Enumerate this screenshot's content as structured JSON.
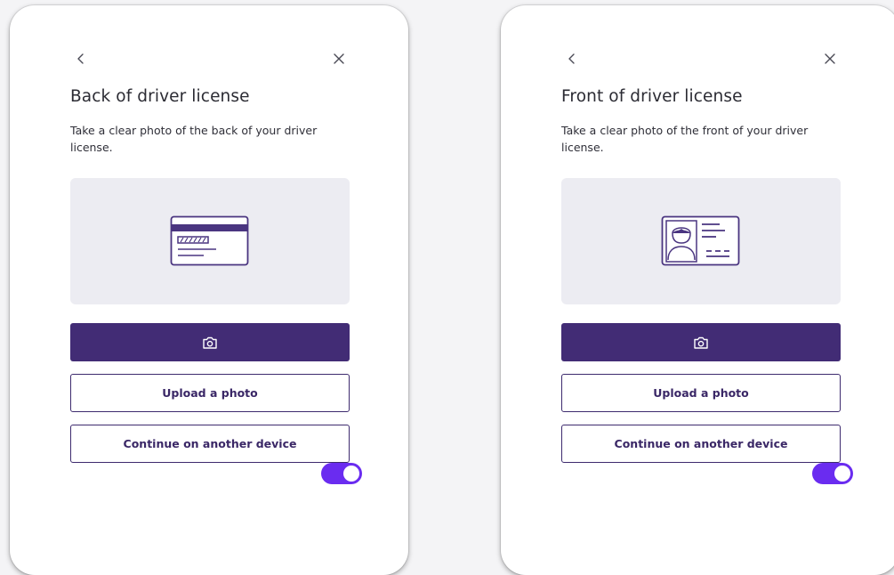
{
  "cards": [
    {
      "title": "Back of driver license",
      "description": "Take a clear photo of the back of your driver license.",
      "illustration_icon": "id-card-back-icon",
      "camera_button_icon": "camera-icon",
      "upload_label": "Upload a photo",
      "continue_label": "Continue on another device",
      "toggle_on": true
    },
    {
      "title": "Front of driver license",
      "description": "Take a clear photo of the front of your driver license.",
      "illustration_icon": "id-card-front-icon",
      "camera_button_icon": "camera-icon",
      "upload_label": "Upload a photo",
      "continue_label": "Continue on another device",
      "toggle_on": true
    }
  ],
  "colors": {
    "primary": "#422c75",
    "outline": "#3d2a6e",
    "toggle": "#6a2cf0",
    "illustration_bg": "#ececf2",
    "icon": "#4a3580"
  }
}
